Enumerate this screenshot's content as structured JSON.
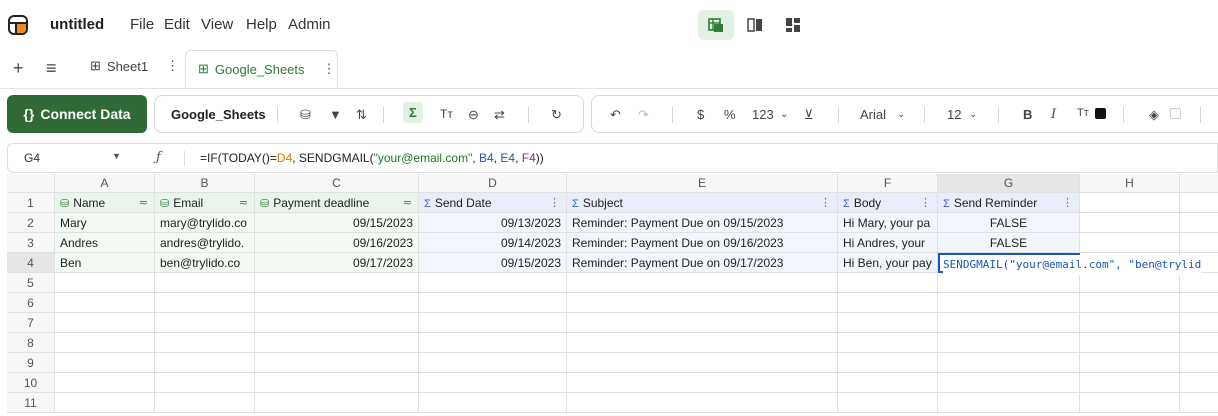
{
  "app": {
    "title": "untitled",
    "menu": [
      "File",
      "Edit",
      "View",
      "Help",
      "Admin"
    ]
  },
  "view_switch": [
    {
      "icon": "grid-view-icon",
      "active": true
    },
    {
      "icon": "split-view-icon",
      "active": false
    },
    {
      "icon": "dashboard-view-icon",
      "active": false
    }
  ],
  "tabs": {
    "add_icon": "plus-icon",
    "list_icon": "menu-icon",
    "items": [
      {
        "label": "Sheet1",
        "active": false
      },
      {
        "label": "Google_Sheets",
        "active": true
      }
    ]
  },
  "toolbar": {
    "connect_label": "Connect Data",
    "source_name": "Google_Sheets",
    "number_format": "123",
    "currency": "$",
    "percent": "%",
    "font": "Arial",
    "font_size": "12",
    "bold": "B",
    "italic": "I"
  },
  "formula_bar": {
    "cell_ref": "G4",
    "fx": "ƒ",
    "parts": [
      "=IF(TODAY()=",
      "D4",
      ", SENDGMAIL(",
      "\"your@email.com\"",
      ", ",
      "B4",
      ", ",
      "E4",
      ", ",
      "F4",
      "))"
    ]
  },
  "columns": [
    "A",
    "B",
    "C",
    "D",
    "E",
    "F",
    "G",
    "H"
  ],
  "rows": [
    "1",
    "2",
    "3",
    "4",
    "5",
    "6",
    "7",
    "8",
    "9",
    "10",
    "11"
  ],
  "headers": {
    "A": "Name",
    "B": "Email",
    "C": "Payment deadline",
    "D": "Send Date",
    "E": "Subject",
    "F": "Body",
    "G": "Send Reminder"
  },
  "data_rows": [
    {
      "A": "Mary",
      "B": "mary@trylido.co",
      "C": "09/15/2023",
      "D": "09/13/2023",
      "E": "Reminder: Payment Due on 09/15/2023",
      "F": "Hi Mary, your pa",
      "G": "FALSE"
    },
    {
      "A": "Andres",
      "B": "andres@trylido.",
      "C": "09/16/2023",
      "D": "09/14/2023",
      "E": "Reminder: Payment Due on 09/16/2023",
      "F": "Hi Andres, your",
      "G": "FALSE"
    },
    {
      "A": "Ben",
      "B": "ben@trylido.co",
      "C": "09/17/2023",
      "D": "09/15/2023",
      "E": "Reminder: Payment Due on 09/17/2023",
      "F": "Hi Ben, your pay",
      "G": "SENDGMAIL(\"your@email.com\", \"ben@trylid"
    }
  ],
  "colors": {
    "brand_green": "#2f6a37",
    "formula_blue": "#1a58b8",
    "sheet_header_green": "#e9f4ea",
    "formula_header_blue": "#e8edf9"
  }
}
